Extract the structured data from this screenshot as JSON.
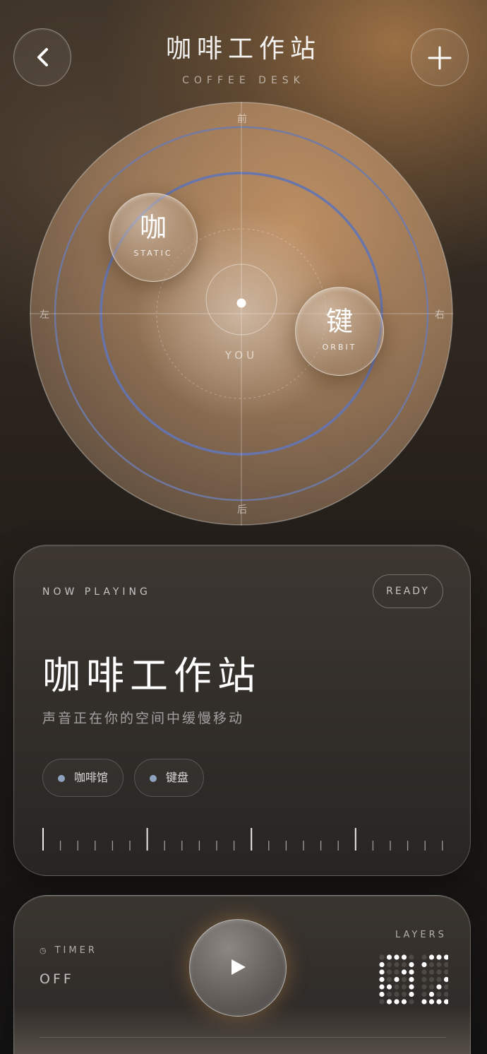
{
  "header": {
    "title": "咖啡工作站",
    "subtitle": "COFFEE DESK",
    "back_icon": "chevron-left-icon",
    "add_icon": "plus-icon"
  },
  "radar": {
    "directions": {
      "front": "前",
      "back": "后",
      "left": "左",
      "right": "右"
    },
    "listener_label": "YOU",
    "sources": [
      {
        "char": "咖",
        "mode": "STATIC"
      },
      {
        "char": "键",
        "mode": "ORBIT"
      }
    ],
    "ring_color": "#6f7aa8"
  },
  "now_playing": {
    "label": "NOW PLAYING",
    "status": "READY",
    "title": "咖啡工作站",
    "description": "声音正在你的空间中缓慢移动",
    "tags": [
      {
        "label": "咖啡馆",
        "color": "#8fa3bf"
      },
      {
        "label": "键盘",
        "color": "#8fa3bf"
      }
    ]
  },
  "controls": {
    "timer_label": "TIMER",
    "timer_icon": "clock-icon",
    "timer_value": "OFF",
    "play_icon": "play-icon",
    "layers_label": "LAYERS",
    "layers_count": "02"
  }
}
